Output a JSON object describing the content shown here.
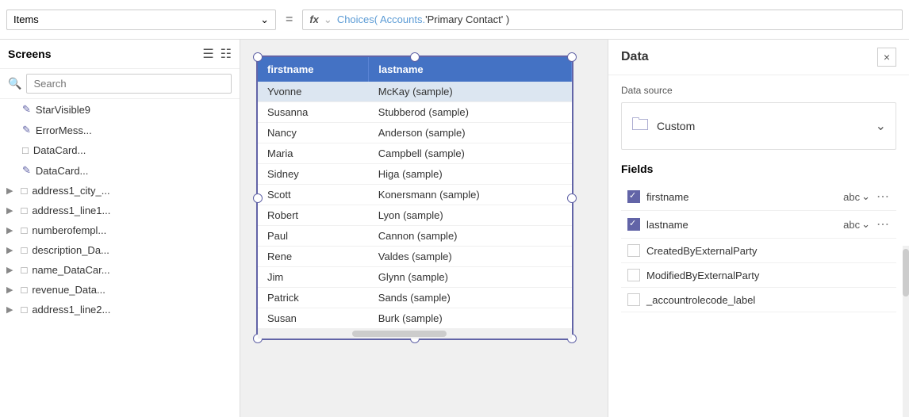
{
  "topbar": {
    "items_label": "Items",
    "equals": "=",
    "fx_label": "fx",
    "formula": "Choices( Accounts.'Primary Contact' )",
    "formula_choices": "Choices(",
    "formula_accounts": " Accounts.",
    "formula_contact": "'Primary Contact'",
    "formula_close": " )",
    "chevron": "∨"
  },
  "sidebar": {
    "title": "Screens",
    "search_placeholder": "Search",
    "items": [
      {
        "id": "star-visible9",
        "label": "StarVisible9",
        "icon": "edit",
        "indent": 1,
        "expandable": false
      },
      {
        "id": "error-mess",
        "label": "ErrorMess...",
        "icon": "edit",
        "indent": 1,
        "expandable": false
      },
      {
        "id": "datacard-1",
        "label": "DataCard...",
        "icon": "card",
        "indent": 1,
        "expandable": false
      },
      {
        "id": "datacard-2",
        "label": "DataCard...",
        "icon": "edit",
        "indent": 1,
        "expandable": false
      },
      {
        "id": "address1-city",
        "label": "address1_city_...",
        "icon": "card",
        "indent": 0,
        "expandable": true
      },
      {
        "id": "address1-line1",
        "label": "address1_line1...",
        "icon": "card",
        "indent": 0,
        "expandable": true
      },
      {
        "id": "numberofempl",
        "label": "numberofempl...",
        "icon": "card",
        "indent": 0,
        "expandable": true
      },
      {
        "id": "description-da",
        "label": "description_Da...",
        "icon": "card",
        "indent": 0,
        "expandable": true
      },
      {
        "id": "name-datacar",
        "label": "name_DataCar...",
        "icon": "card",
        "indent": 0,
        "expandable": true
      },
      {
        "id": "revenue-data",
        "label": "revenue_Data...",
        "icon": "card",
        "indent": 0,
        "expandable": true
      },
      {
        "id": "address1-line2",
        "label": "address1_line2...",
        "icon": "card",
        "indent": 0,
        "expandable": true
      }
    ]
  },
  "gallery": {
    "columns": [
      "firstname",
      "lastname"
    ],
    "rows": [
      [
        "Yvonne",
        "McKay (sample)"
      ],
      [
        "Susanna",
        "Stubberod (sample)"
      ],
      [
        "Nancy",
        "Anderson (sample)"
      ],
      [
        "Maria",
        "Campbell (sample)"
      ],
      [
        "Sidney",
        "Higa (sample)"
      ],
      [
        "Scott",
        "Konersmann (sample)"
      ],
      [
        "Robert",
        "Lyon (sample)"
      ],
      [
        "Paul",
        "Cannon (sample)"
      ],
      [
        "Rene",
        "Valdes (sample)"
      ],
      [
        "Jim",
        "Glynn (sample)"
      ],
      [
        "Patrick",
        "Sands (sample)"
      ],
      [
        "Susan",
        "Burk (sample)"
      ]
    ]
  },
  "right_panel": {
    "title": "Data",
    "close_label": "×",
    "datasource_label": "Data source",
    "datasource_name": "Custom",
    "fields_label": "Fields",
    "fields": [
      {
        "id": "firstname",
        "name": "firstname",
        "type": "abc",
        "checked": true
      },
      {
        "id": "lastname",
        "name": "lastname",
        "type": "abc",
        "checked": true
      },
      {
        "id": "createdbyexternalparty",
        "name": "CreatedByExternalParty",
        "type": "",
        "checked": false
      },
      {
        "id": "modifiedbyexternalparty",
        "name": "ModifiedByExternalParty",
        "type": "",
        "checked": false
      },
      {
        "id": "accountrolecode-label",
        "name": "_accountrolecode_label",
        "type": "",
        "checked": false
      }
    ]
  }
}
